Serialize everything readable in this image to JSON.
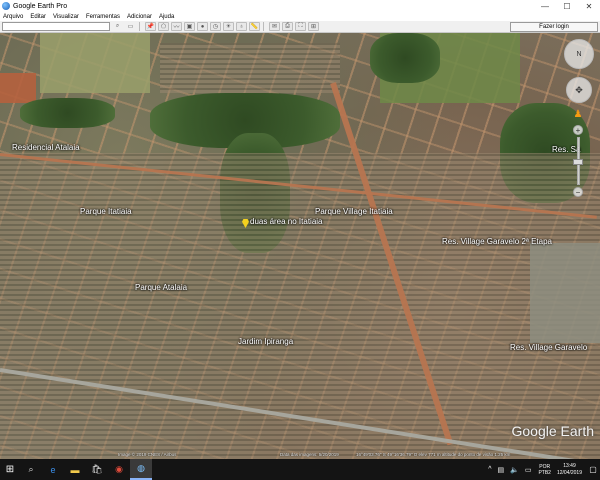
{
  "window": {
    "title": "Google Earth Pro",
    "minimize": "—",
    "maximize": "☐",
    "close": "✕"
  },
  "menu": [
    "Arquivo",
    "Editar",
    "Visualizar",
    "Ferramentas",
    "Adicionar",
    "Ajuda"
  ],
  "toolbar": {
    "login_label": "Fazer login"
  },
  "map": {
    "labels": [
      "Residencial Atalaia",
      "Parque Itatiaia",
      "duas área no Itatiaia",
      "Parque Village Itatiaia",
      "Parque Atalaia",
      "Jardim Ipiranga",
      "Res. Village Garavelo 2ª Etapa",
      "Res. Village Garavelo",
      "Res. Sa"
    ],
    "watermark": "Google Earth"
  },
  "statusbar": {
    "image_credit": "Image © 2019 CNES / Airbus",
    "imagery_date": "Data das imagens: 5/20/2019",
    "coordinates": "16°49'03.76\" S  49°16'36.79\" O  elev 771 m  altitude do ponto de visão 1.25 km"
  },
  "taskbar": {
    "apps": [
      "windows-icon",
      "search-icon",
      "edge-icon",
      "explorer-icon",
      "store-icon",
      "chrome-icon",
      "google-earth-icon"
    ],
    "lang_top": "POR",
    "lang_bottom": "PTB2",
    "time": "13:49",
    "date": "12/04/2019"
  }
}
